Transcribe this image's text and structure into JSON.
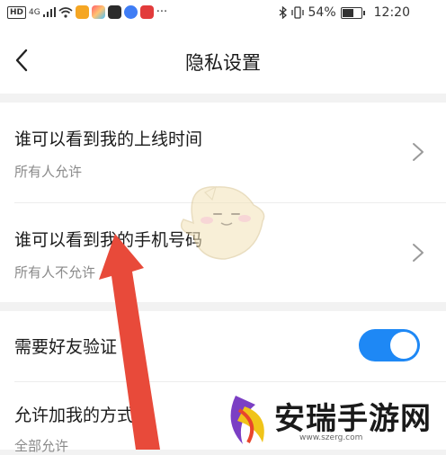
{
  "status_bar": {
    "network_label": "HD",
    "signal_label": "4G",
    "battery_percent": "54%",
    "time": "12:20",
    "more_icon": "···",
    "app_icons": [
      "camera-app-icon",
      "photos-app-icon",
      "store-app-icon",
      "music-app-icon",
      "notes-app-icon"
    ]
  },
  "header": {
    "title": "隐私设置",
    "back_icon": "chevron-left-icon"
  },
  "privacy": {
    "items": [
      {
        "title": "谁可以看到我的上线时间",
        "value": "所有人允许"
      },
      {
        "title": "谁可以看到我的手机号码",
        "value": "所有人不允许"
      }
    ]
  },
  "friends": {
    "verify_label": "需要好友验证",
    "verify_enabled": true,
    "add_methods_label": "允许加我的方式",
    "add_methods_value": "全部允许"
  },
  "watermark": {
    "name": "安瑞手游网",
    "url": "www.szerg.com"
  },
  "colors": {
    "toggle_on": "#1e88f5",
    "arrow": "#e84a3a"
  }
}
